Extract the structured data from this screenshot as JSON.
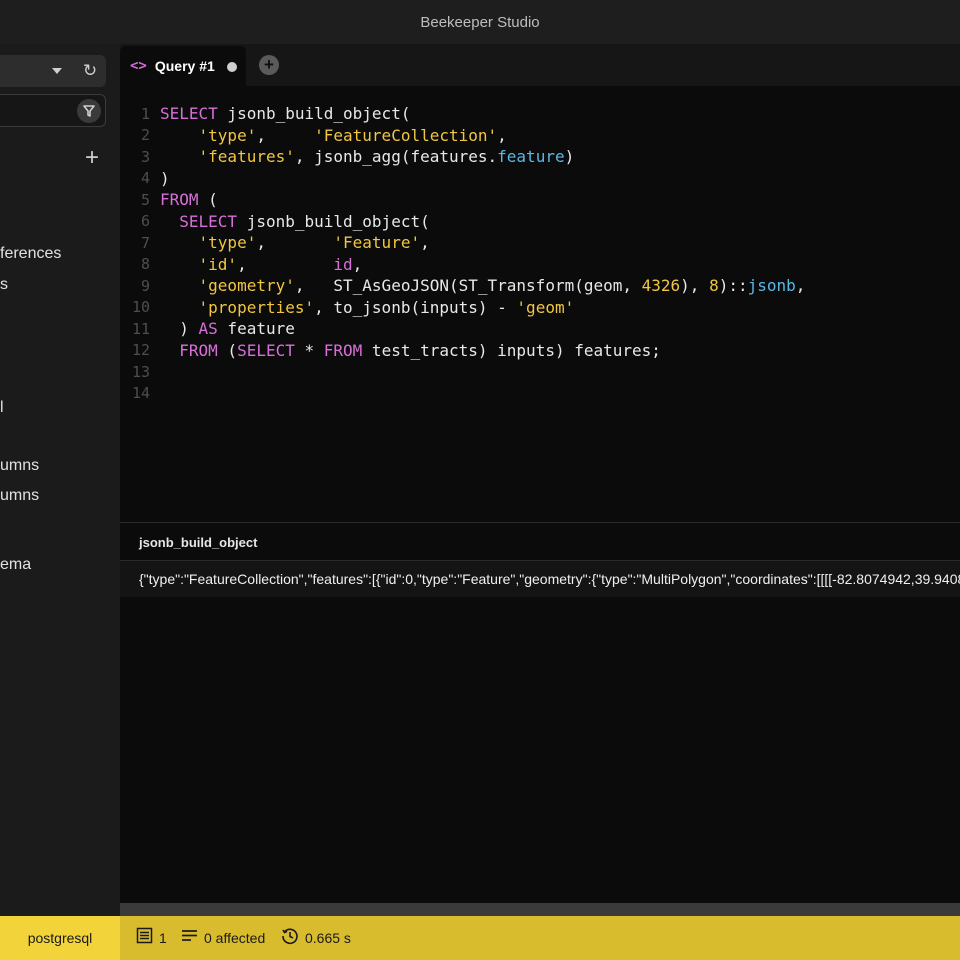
{
  "window": {
    "title": "Beekeeper Studio"
  },
  "sidebar": {
    "items": [
      {
        "label": "ferences"
      },
      {
        "label": "s"
      },
      {
        "label": "l"
      },
      {
        "label": "umns"
      },
      {
        "label": "umns"
      },
      {
        "label": "ema"
      }
    ]
  },
  "tabs": [
    {
      "label": "Query #1",
      "unsaved": true
    }
  ],
  "editor": {
    "line_numbers": [
      "1",
      "2",
      "3",
      "4",
      "5",
      "6",
      "7",
      "8",
      "9",
      "10",
      "11",
      "12",
      "13",
      "14"
    ]
  },
  "results": {
    "column_header": "jsonb_build_object",
    "rows": [
      "{\"type\":\"FeatureCollection\",\"features\":[{\"id\":0,\"type\":\"Feature\",\"geometry\":{\"type\":\"MultiPolygon\",\"coordinates\":[[[[-82.8074942,39.9408"
    ]
  },
  "status": {
    "connection_type": "postgresql",
    "row_count": "1",
    "affected": "0 affected",
    "duration": "0.665 s"
  },
  "colors": {
    "keyword": "#d76fd9",
    "string": "#f2c641",
    "property": "#5bb8e6",
    "status_bar": "#d9bb2e"
  }
}
